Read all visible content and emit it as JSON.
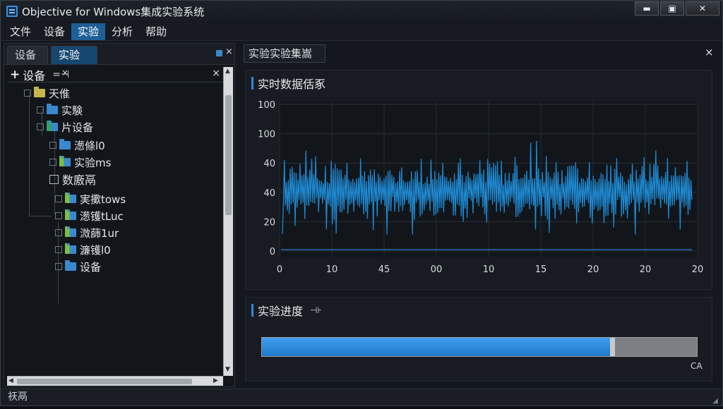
{
  "window": {
    "title": "Objective for Windows集成实验系统",
    "controls": {
      "minimize": "▬",
      "maximize": "▣",
      "close": "✕"
    }
  },
  "menu": [
    "文件",
    "设备",
    "实验",
    "分析",
    "帮助"
  ],
  "menu_active_index": 2,
  "left_panel": {
    "tabs": [
      {
        "label": "设备"
      },
      {
        "label": "实验",
        "close": "×"
      }
    ],
    "close_glyph": "×",
    "tree_header": {
      "plus": "+",
      "label": "设备",
      "symbol": "=⊣",
      "close": "×"
    },
    "tree": [
      {
        "label": "天倠",
        "folder": "yellow",
        "expander": "⊞"
      },
      {
        "label": "实験",
        "folder": "blue",
        "expander": "⊞"
      },
      {
        "label": "片设备",
        "folder": "teal",
        "expander": "⊞"
      },
      {
        "label": "濍條l0",
        "folder": "blue",
        "expander": "⊞"
      },
      {
        "label": "实验ms",
        "folder": "green",
        "expander": "○"
      },
      {
        "label": "数廒鬲",
        "folder": "box",
        "expander": ""
      },
      {
        "label": "実擹tows",
        "folder": "green",
        "expander": "⊞"
      },
      {
        "label": "濍镬tLuc",
        "folder": "green",
        "expander": "⊞"
      },
      {
        "label": "溦蒒1ur",
        "folder": "green",
        "expander": "⊞"
      },
      {
        "label": "濂镬l0",
        "folder": "green",
        "expander": "⊞"
      },
      {
        "label": "设备",
        "folder": "blue",
        "expander": "⊞"
      }
    ]
  },
  "right_header": {
    "title": "实验实验集嵩",
    "close": "×"
  },
  "chart_panel": {
    "title": "实时数据佸豖"
  },
  "chart_data": {
    "type": "line",
    "title": "实时数据佸豖",
    "y_tick_labels": [
      "100",
      "100",
      "40",
      "40",
      "20",
      "0"
    ],
    "x_tick_labels": [
      "0",
      "10",
      "45",
      "00",
      "10",
      "15",
      "20",
      "20",
      "20"
    ],
    "series": [
      {
        "color": "#1e88d0",
        "baseline": 40,
        "amplitude_min": 5,
        "amplitude_max": 96,
        "samples": 420
      }
    ],
    "baseline_line_value": 0,
    "grid": true
  },
  "progress_panel": {
    "title": "实验进度",
    "symbol": "⊣⊦",
    "progress_fraction": 0.8,
    "percent_label": "CA"
  },
  "status_bar": {
    "text": "祆鬲",
    "grip": "◢"
  },
  "colors": {
    "accent": "#1e5f96",
    "series": "#1e88d0",
    "progress": "#2d8ae0"
  }
}
